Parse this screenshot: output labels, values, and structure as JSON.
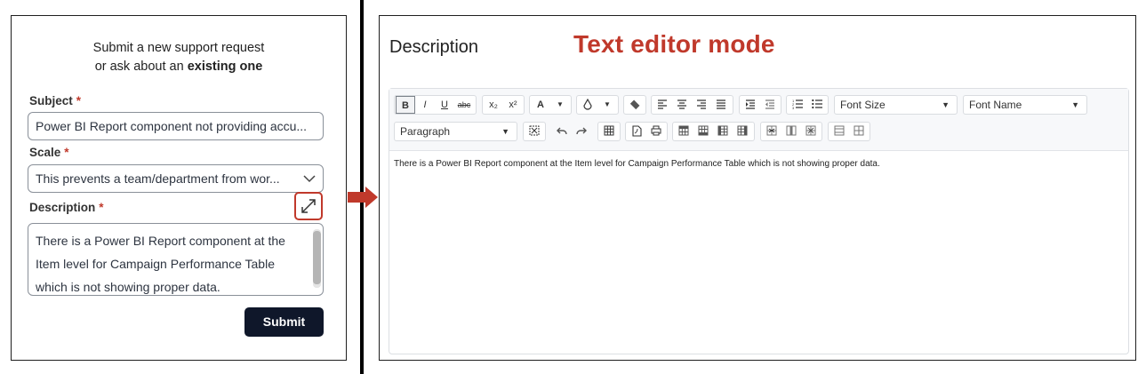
{
  "form": {
    "heading_line1": "Submit a new support request",
    "heading_line2_prefix": "or ask about an ",
    "heading_line2_bold": "existing one",
    "subject": {
      "label": "Subject",
      "required_mark": "*",
      "value": "Power BI Report component not providing accu..."
    },
    "scale": {
      "label": "Scale",
      "required_mark": "*",
      "value": "This prevents a team/department from wor..."
    },
    "description": {
      "label": "Description",
      "required_mark": "*",
      "value": "There is a Power BI Report component at the Item level for Campaign Performance Table which is not showing proper data."
    },
    "submit_label": "Submit"
  },
  "editor": {
    "title": "Description",
    "mode_label": "Text editor mode",
    "font_size_placeholder": "Font Size",
    "font_name_placeholder": "Font Name",
    "block_format": "Paragraph",
    "content": "There is a Power BI Report component at the Item level for Campaign Performance Table which is not showing proper data.",
    "buttons": {
      "bold": "B",
      "italic": "I",
      "underline": "U",
      "strike": "abc",
      "subscript": "x₂",
      "superscript": "x²",
      "font_color": "A"
    }
  },
  "colors": {
    "accent_red": "#c0392b",
    "submit_bg": "#0f172a"
  },
  "icons": [
    "expand-icon",
    "chevron-down-icon",
    "arrow-right-icon",
    "droplet-icon",
    "eraser-icon",
    "align-left-icon",
    "align-center-icon",
    "align-right-icon",
    "justify-icon",
    "indent-icon",
    "outdent-icon",
    "ordered-list-icon",
    "unordered-list-icon",
    "fullscreen-icon",
    "undo-icon",
    "redo-icon",
    "table-icon",
    "pdf-icon",
    "print-icon"
  ]
}
